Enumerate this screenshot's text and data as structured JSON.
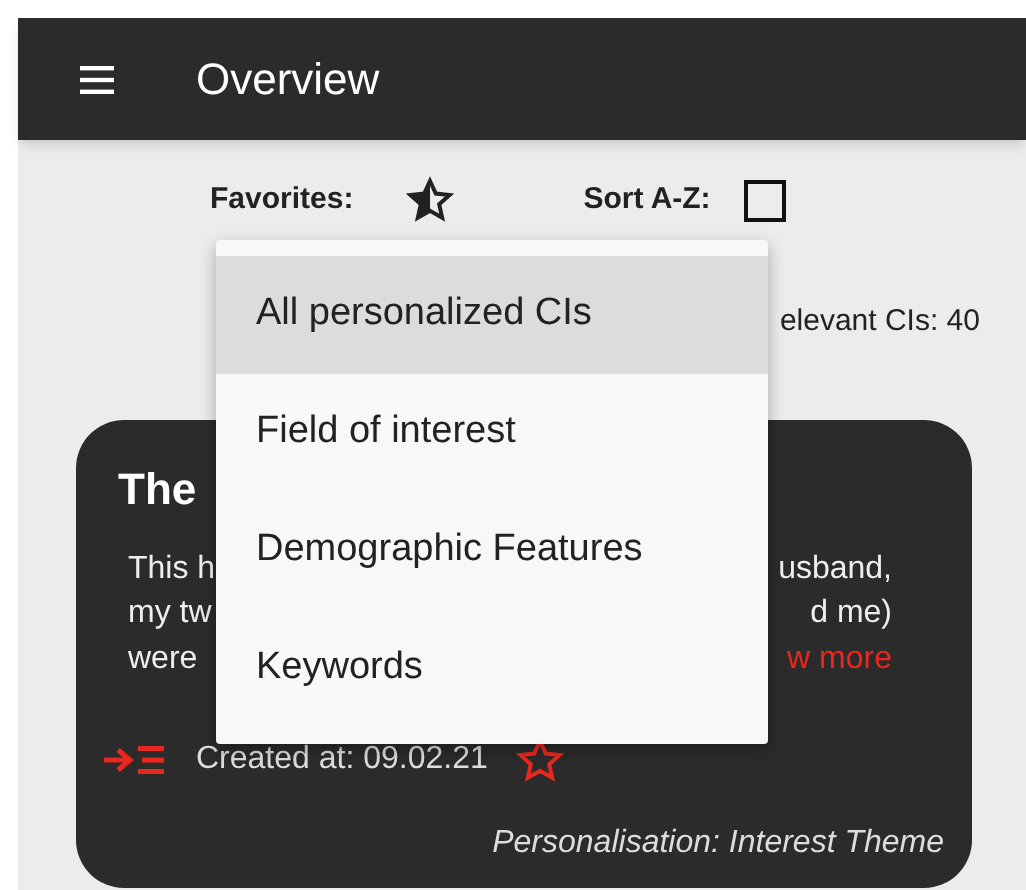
{
  "app_bar": {
    "title": "Overview"
  },
  "filters": {
    "favorites_label": "Favorites:",
    "sort_label": "Sort A-Z:",
    "sort_checked": false
  },
  "relevant_count": "elevant CIs: 40",
  "menu": [
    {
      "label": "All personalized CIs",
      "selected": true
    },
    {
      "label": "Field of interest",
      "selected": false
    },
    {
      "label": "Demographic Features",
      "selected": false
    },
    {
      "label": "Keywords",
      "selected": false
    }
  ],
  "card": {
    "title": "The",
    "body": [
      {
        "start": "This h",
        "end": "usband,",
        "end_is_link": false
      },
      {
        "start": "my tw",
        "end": "d me)",
        "end_is_link": false
      },
      {
        "start": "were",
        "end": "w more",
        "end_is_link": true
      }
    ],
    "created": "Created at: 09.02.21",
    "favorite": false,
    "personalisation": "Personalisation: Interest Theme"
  }
}
